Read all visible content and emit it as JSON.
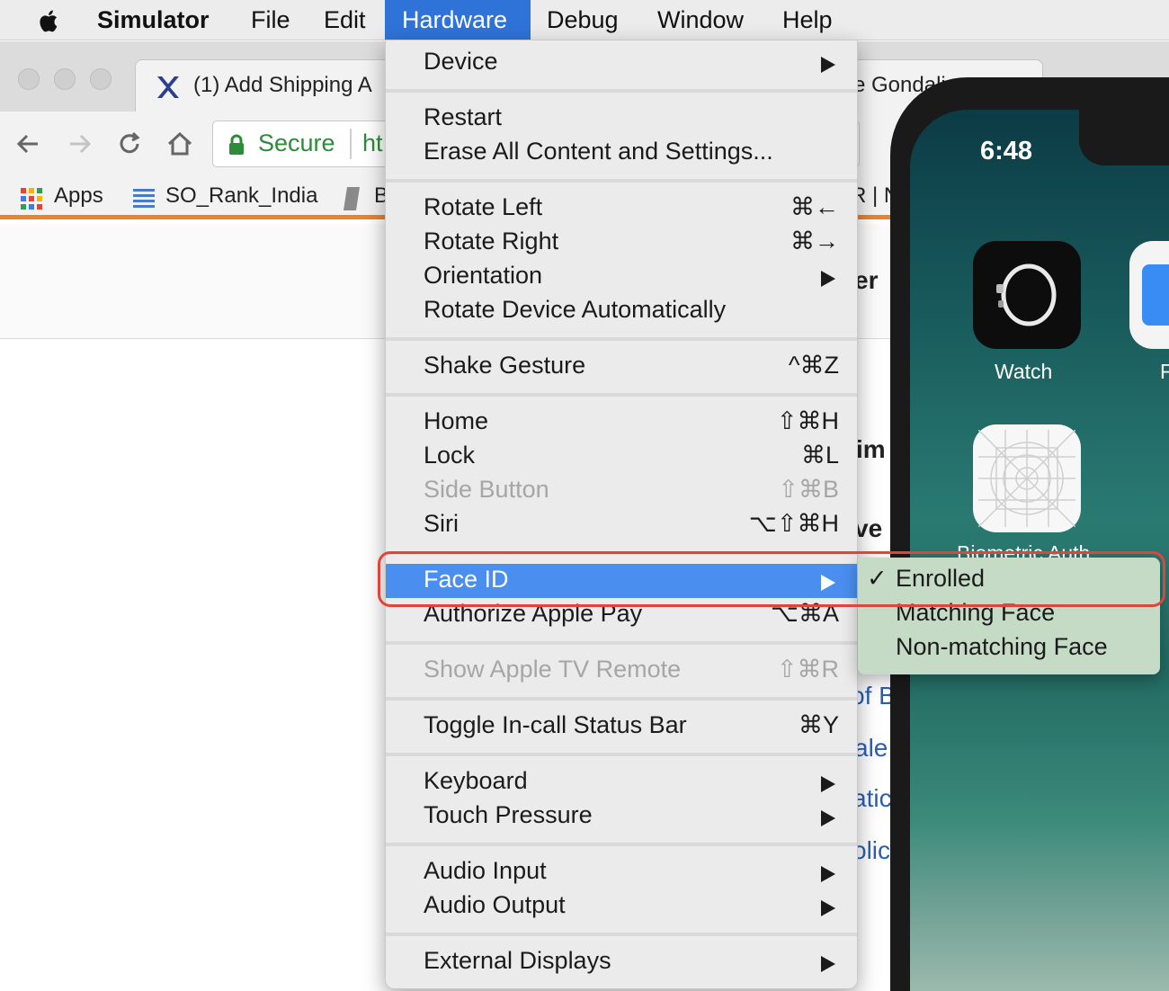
{
  "menubar": {
    "app_name": "Simulator",
    "items": [
      "File",
      "Edit",
      "Hardware",
      "Debug",
      "Window",
      "Help"
    ],
    "active_item": "Hardware"
  },
  "browser": {
    "tab1_title": "(1) Add Shipping A",
    "tab2_title": "e Gondali",
    "secure_label": "Secure",
    "url_fragment": "ht",
    "bookmarks": [
      "Apps",
      "SO_Rank_India",
      "B"
    ],
    "bookmark_tail": "R | N",
    "peek": {
      "er": "er",
      "im": "im",
      "ve": "ve",
      "of_b": "of B",
      "ale": "ale",
      "atic": "atic",
      "olic": "olic"
    }
  },
  "simulator": {
    "time": "6:48",
    "apps": {
      "watch": "Watch",
      "second": "F",
      "biometric": "Biometric Auth"
    }
  },
  "hardware_menu": {
    "device": "Device",
    "restart": "Restart",
    "erase": "Erase All Content and Settings...",
    "rotate_left": "Rotate Left",
    "rotate_left_sc": "⌘←",
    "rotate_right": "Rotate Right",
    "rotate_right_sc": "⌘→",
    "orientation": "Orientation",
    "rotate_auto": "Rotate Device Automatically",
    "shake": "Shake Gesture",
    "shake_sc": "^⌘Z",
    "home": "Home",
    "home_sc": "⇧⌘H",
    "lock": "Lock",
    "lock_sc": "⌘L",
    "side_button": "Side Button",
    "side_button_sc": "⇧⌘B",
    "siri": "Siri",
    "siri_sc": "⌥⇧⌘H",
    "face_id": "Face ID",
    "apple_pay": "Authorize Apple Pay",
    "apple_pay_sc": "⌥⌘A",
    "apple_tv": "Show Apple TV Remote",
    "apple_tv_sc": "⇧⌘R",
    "toggle_status": "Toggle In-call Status Bar",
    "toggle_status_sc": "⌘Y",
    "keyboard": "Keyboard",
    "touch_pressure": "Touch Pressure",
    "audio_input": "Audio Input",
    "audio_output": "Audio Output",
    "external_displays": "External Displays"
  },
  "face_id_submenu": {
    "check": "✓",
    "enrolled": "Enrolled",
    "matching": "Matching Face",
    "non_matching": "Non-matching Face"
  },
  "colors": {
    "menu_highlight": "#4a8ef0",
    "annotation": "#e0443a",
    "secure_green": "#2e8b3a",
    "bookmark_bar_accent": "#e8842f"
  }
}
